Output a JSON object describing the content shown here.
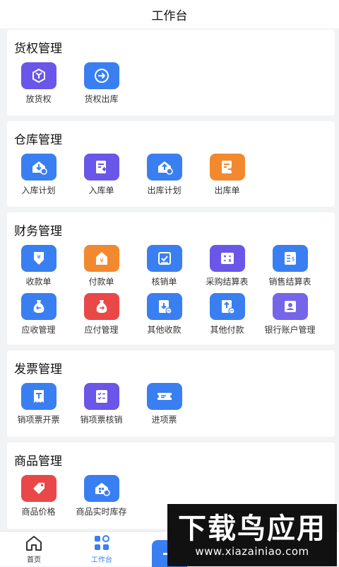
{
  "header": {
    "title": "工作台"
  },
  "sections": {
    "goods_right": {
      "title": "货权管理",
      "items": [
        {
          "label": "放货权",
          "icon": "cube-icon",
          "color": "#6a56e8"
        },
        {
          "label": "货权出库",
          "icon": "arrow-right-icon",
          "color": "#3a7ff1"
        }
      ]
    },
    "warehouse": {
      "title": "仓库管理",
      "items": [
        {
          "label": "入库计划",
          "icon": "warehouse-in-plan-icon",
          "color": "#3a7ff1"
        },
        {
          "label": "入库单",
          "icon": "inbound-form-icon",
          "color": "#6a56e8"
        },
        {
          "label": "出库计划",
          "icon": "warehouse-out-plan-icon",
          "color": "#3a7ff1"
        },
        {
          "label": "出库单",
          "icon": "outbound-form-icon",
          "color": "#f2892e"
        }
      ]
    },
    "finance": {
      "title": "财务管理",
      "items": [
        {
          "label": "收款单",
          "icon": "receipt-yuan-icon",
          "color": "#3a7ff1"
        },
        {
          "label": "付款单",
          "icon": "payment-yuan-icon",
          "color": "#f2892e"
        },
        {
          "label": "核销单",
          "icon": "writeoff-icon",
          "color": "#3a7ff1"
        },
        {
          "label": "采购结算表",
          "icon": "calculator-icon",
          "color": "#6a56e8"
        },
        {
          "label": "销售结算表",
          "icon": "sales-statement-icon",
          "color": "#3a7ff1"
        },
        {
          "label": "应收管理",
          "icon": "receivable-bag-icon",
          "color": "#3a7ff1"
        },
        {
          "label": "应付管理",
          "icon": "payable-bag-icon",
          "color": "#ea4848"
        },
        {
          "label": "其他收款",
          "icon": "other-receipt-icon",
          "color": "#3a7ff1"
        },
        {
          "label": "其他付款",
          "icon": "other-payment-icon",
          "color": "#3a7ff1"
        },
        {
          "label": "银行账户管理",
          "icon": "bank-account-icon",
          "color": "#7565e8"
        }
      ]
    },
    "invoice": {
      "title": "发票管理",
      "items": [
        {
          "label": "销项票开票",
          "icon": "invoice-issue-icon",
          "color": "#3a7ff1"
        },
        {
          "label": "销项票核销",
          "icon": "invoice-checklist-icon",
          "color": "#6a56e8"
        },
        {
          "label": "进项票",
          "icon": "ticket-icon",
          "color": "#3a7ff1"
        }
      ]
    },
    "goods": {
      "title": "商品管理",
      "items": [
        {
          "label": "商品价格",
          "icon": "price-tag-icon",
          "color": "#ea4848"
        },
        {
          "label": "商品实时库存",
          "icon": "realtime-stock-icon",
          "color": "#3a7ff1"
        }
      ]
    }
  },
  "tabbar": {
    "home": {
      "label": "首页",
      "icon": "home-icon",
      "color": "#333333"
    },
    "workbench": {
      "label": "工作台",
      "icon": "grid-icon",
      "color": "#3a7ff1"
    },
    "fab": {
      "icon": "minus-icon",
      "color": "#3a7ff1"
    }
  },
  "watermark": {
    "big": "下载鸟应用",
    "url": "www.xiazainiao.com"
  }
}
